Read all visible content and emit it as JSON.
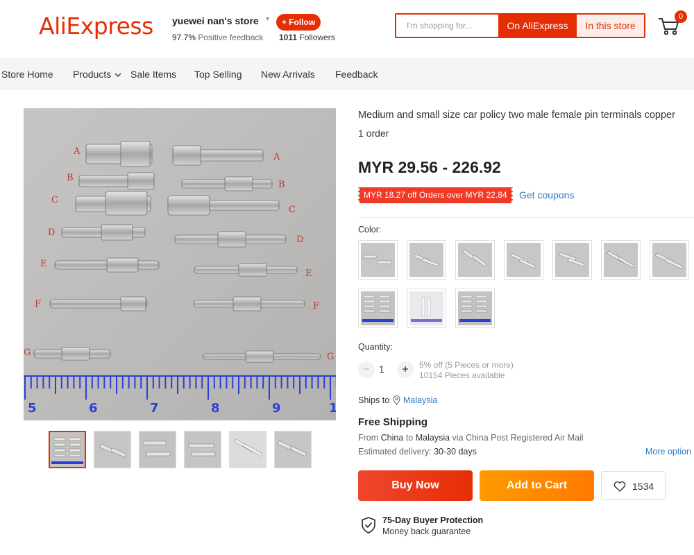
{
  "header": {
    "logo": "AliExpress",
    "store_name": "yuewei nan's store",
    "feedback_pct": "97.7%",
    "feedback_label": "Positive feedback",
    "follow_label": "+ Follow",
    "followers_count": "1011",
    "followers_label": "Followers",
    "search_placeholder": "I'm shopping for...",
    "search_aliexpress": "On AliExpress",
    "search_store": "In this store",
    "cart_count": "0"
  },
  "nav": [
    "Store Home",
    "Products",
    "Sale Items",
    "Top Selling",
    "New Arrivals",
    "Feedback"
  ],
  "product": {
    "title": "Medium and small size car policy two male female pin terminals copper",
    "orders": "1 order",
    "price": "MYR 29.56 - 226.92",
    "coupon": "MYR 18.27 off Orders over MYR 22.84",
    "get_coupons": "Get coupons",
    "color_label": "Color:",
    "quantity_label": "Quantity:",
    "quantity": "1",
    "discount_note": "5% off (5 Pieces or more)",
    "available": "10154 Pieces available",
    "ships_to_label": "Ships to",
    "ships_to_country": "Malaysia",
    "free_shipping": "Free Shipping",
    "ship_from_word": "From",
    "ship_from": "China",
    "ship_to_word": "to",
    "ship_to": "Malaysia",
    "ship_via": "via China Post Registered Air Mail",
    "est_label": "Estimated delivery:",
    "est_value": "30-30 days",
    "more_options": "More option",
    "buy_now": "Buy Now",
    "add_to_cart": "Add to Cart",
    "wishlist_count": "1534",
    "protection_title": "75-Day Buyer Protection",
    "protection_sub": "Money back guarantee"
  },
  "main_image": {
    "row_letters": [
      "A",
      "B",
      "C",
      "D",
      "E",
      "F",
      "G"
    ],
    "ruler_numbers": [
      "5",
      "6",
      "7",
      "8",
      "9",
      "1"
    ]
  },
  "colors": {
    "brand": "#e62e04",
    "link": "#2d7bc5",
    "add_to_cart": "#ff8a00"
  },
  "icons": [
    "cart-icon",
    "pin-icon",
    "heart-icon",
    "shield-check-icon",
    "chevron-down-icon",
    "minus-icon",
    "plus-icon"
  ]
}
